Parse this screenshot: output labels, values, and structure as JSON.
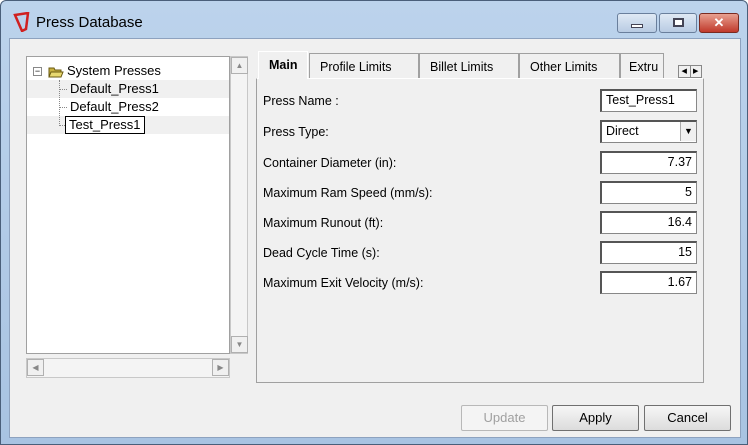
{
  "window": {
    "title": "Press Database",
    "controls": [
      "minimize",
      "maximize",
      "close"
    ]
  },
  "tree": {
    "root": "System Presses",
    "items": [
      "Default_Press1",
      "Default_Press2",
      "Test_Press1"
    ],
    "selected": "Test_Press1"
  },
  "tabs": [
    {
      "label": "Main",
      "active": true
    },
    {
      "label": "Profile Limits"
    },
    {
      "label": "Billet Limits"
    },
    {
      "label": "Other Limits"
    },
    {
      "label": "Extru"
    }
  ],
  "form": {
    "press_name": {
      "label": "Press Name :",
      "value": "Test_Press1"
    },
    "press_type": {
      "label": "Press Type:",
      "value": "Direct"
    },
    "container_diameter": {
      "label": "Container Diameter (in):",
      "value": "7.37"
    },
    "max_ram_speed": {
      "label": "Maximum Ram Speed (mm/s):",
      "value": "5"
    },
    "max_runout": {
      "label": "Maximum Runout (ft):",
      "value": "16.4"
    },
    "dead_cycle_time": {
      "label": "Dead Cycle Time (s):",
      "value": "15"
    },
    "max_exit_velocity": {
      "label": "Maximum Exit Velocity (m/s):",
      "value": "1.67"
    }
  },
  "buttons": {
    "update": "Update",
    "apply": "Apply",
    "cancel": "Cancel"
  }
}
